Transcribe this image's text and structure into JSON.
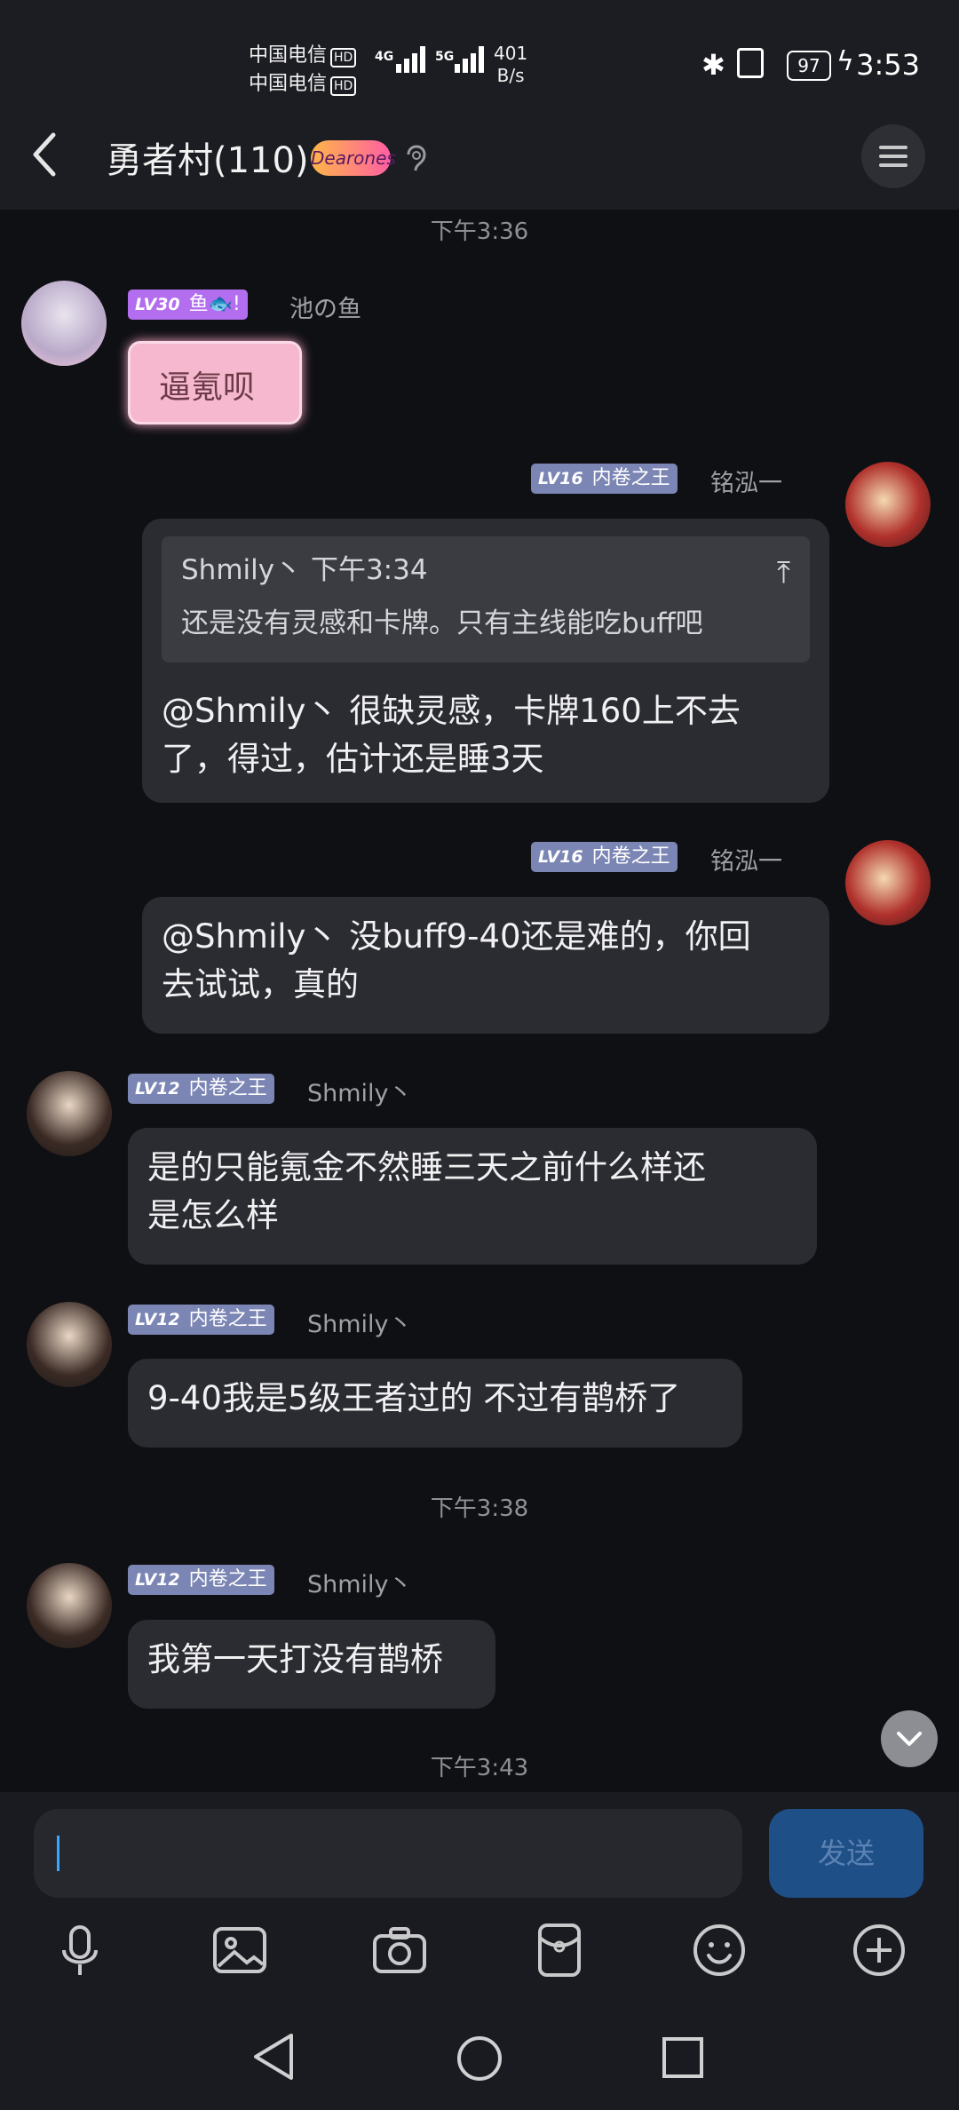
{
  "status_bar": {
    "carrier1": "中国电信",
    "carrier2": "中国电信",
    "hd": "HD",
    "net1": "4G",
    "net2": "5G",
    "speed_value": "401",
    "speed_unit": "B/s",
    "battery": "97",
    "time": "3:53"
  },
  "header": {
    "title": "勇者村(110)",
    "badge_text": "Dearones"
  },
  "timestamps": {
    "t1": "下午3:36",
    "t2": "下午3:38",
    "t3": "下午3:43"
  },
  "messages": [
    {
      "level": "LV30",
      "title": "鱼🐟!",
      "name": "池の鱼",
      "text": "逼氪呗"
    },
    {
      "level": "LV16",
      "title": "内卷之王",
      "name": "铭泓一",
      "quote_header": "Shmily丶  下午3:34",
      "quote_text": "还是没有灵感和卡牌。只有主线能吃buff吧",
      "line1": "@Shmily丶 很缺灵感，卡牌160上不去",
      "line2": "了，得过，估计还是睡3天"
    },
    {
      "level": "LV16",
      "title": "内卷之王",
      "name": "铭泓一",
      "line1": "@Shmily丶 没buff9-40还是难的，你回",
      "line2": "去试试，真的"
    },
    {
      "level": "LV12",
      "title": "内卷之王",
      "name": "Shmily丶",
      "line1": "是的只能氪金不然睡三天之前什么样还",
      "line2": "是怎么样"
    },
    {
      "level": "LV12",
      "title": "内卷之王",
      "name": "Shmily丶",
      "text": "9-40我是5级王者过的 不过有鹊桥了"
    },
    {
      "level": "LV12",
      "title": "内卷之王",
      "name": "Shmily丶",
      "text": "我第一天打没有鹊桥"
    }
  ],
  "input": {
    "send_label": "发送"
  },
  "colors": {
    "accent": "#1f4f87",
    "bubble": "#2b2c31",
    "background": "#0f1014"
  }
}
